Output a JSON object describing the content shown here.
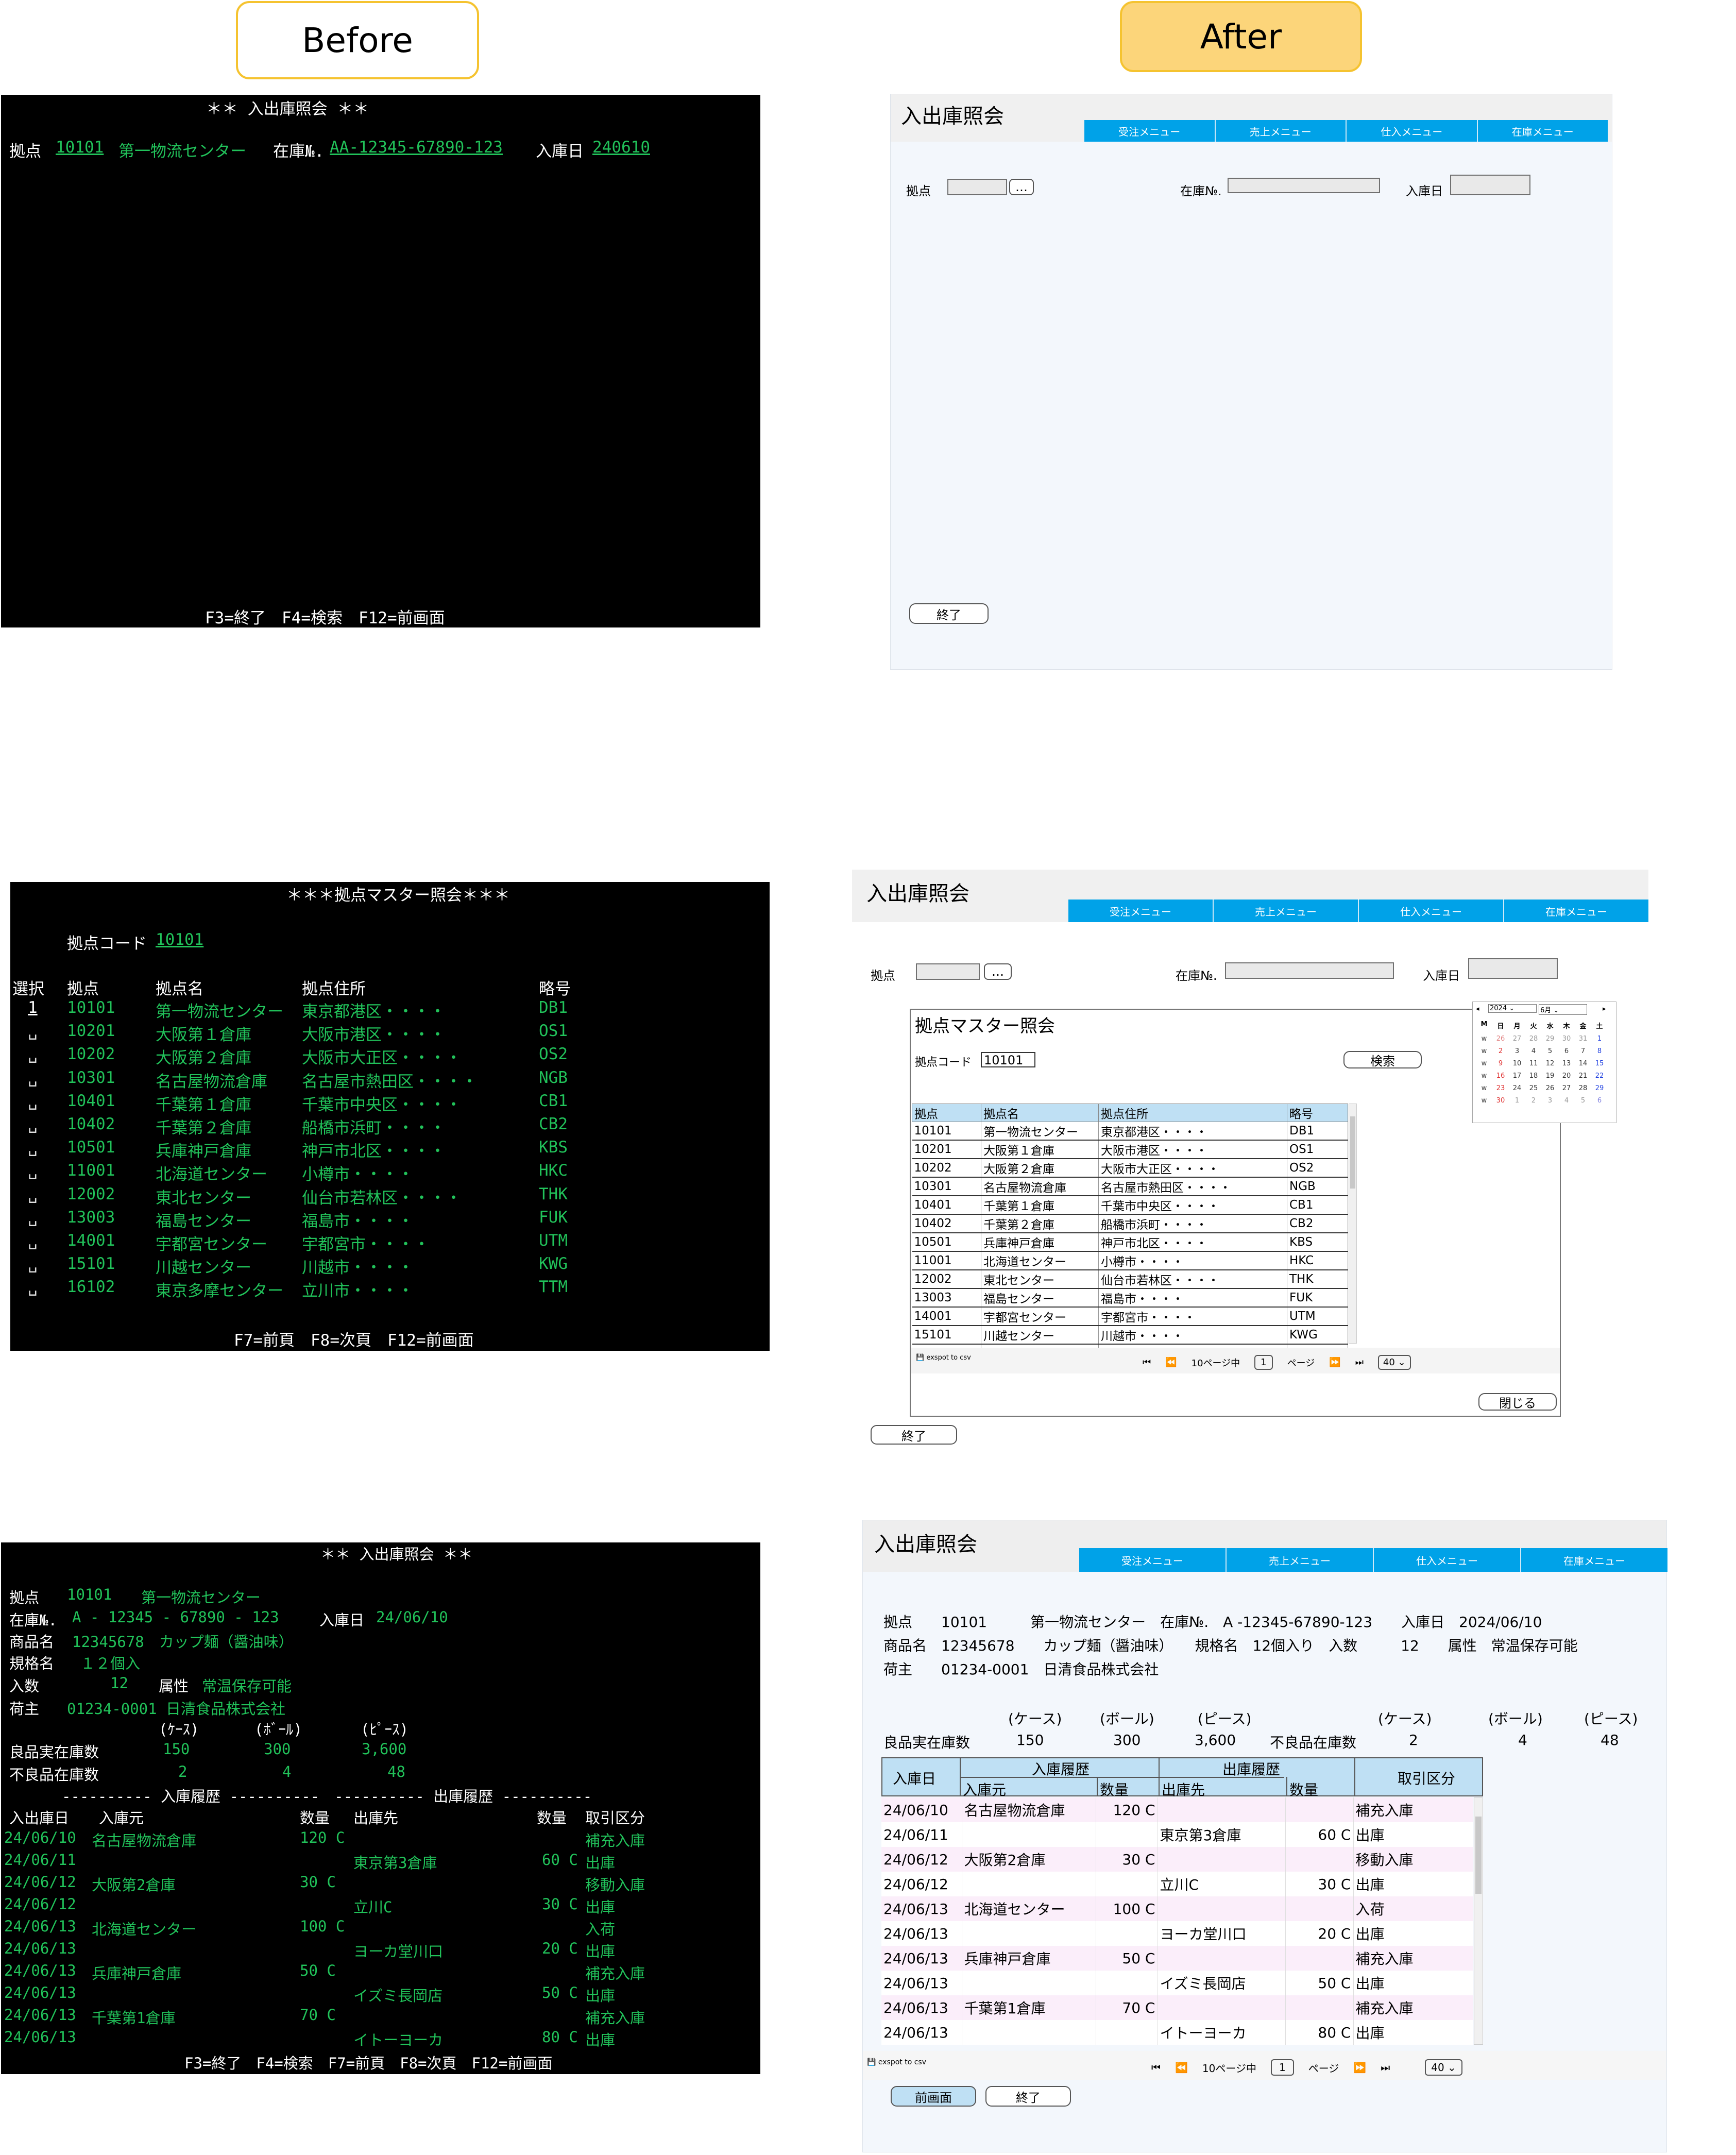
{
  "labels": {
    "before": "Before",
    "after": "After"
  },
  "s1": {
    "title": "＊＊ 入出庫照会 ＊＊",
    "lbl_kyoten": "拠点",
    "kyoten": "10101",
    "kyoten_name": "第一物流センター",
    "lbl_zaiko": "在庫№.",
    "zaiko": "AA-12345-67890-123",
    "lbl_date": "入庫日",
    "date": "240610",
    "fkeys": "F3=終了　F4=検索　F12=前画面"
  },
  "a1": {
    "title": "入出庫照会",
    "menu": [
      "受注メニュー",
      "売上メニュー",
      "仕入メニュー",
      "在庫メニュー"
    ],
    "lbl_kyoten": "拠点",
    "lookup": "…",
    "lbl_zaiko": "在庫№.",
    "lbl_date": "入庫日",
    "end": "終了"
  },
  "s2": {
    "title": "＊＊＊拠点マスター照会＊＊＊",
    "lbl_code": "拠点コード",
    "code": "10101",
    "headers": [
      "選択",
      "拠点",
      "拠点名",
      "拠点住所",
      "略号"
    ],
    "sel_first": "1",
    "sel": "␣",
    "rows": [
      [
        "10101",
        "第一物流センター",
        "東京都港区・・・・",
        "DB1"
      ],
      [
        "10201",
        "大阪第１倉庫",
        "大阪市港区・・・・",
        "OS1"
      ],
      [
        "10202",
        "大阪第２倉庫",
        "大阪市大正区・・・・",
        "OS2"
      ],
      [
        "10301",
        "名古屋物流倉庫",
        "名古屋市熱田区・・・・",
        "NGB"
      ],
      [
        "10401",
        "千葉第１倉庫",
        "千葉市中央区・・・・",
        "CB1"
      ],
      [
        "10402",
        "千葉第２倉庫",
        "船橋市浜町・・・・",
        "CB2"
      ],
      [
        "10501",
        "兵庫神戸倉庫",
        "神戸市北区・・・・",
        "KBS"
      ],
      [
        "11001",
        "北海道センター",
        "小樽市・・・・",
        "HKC"
      ],
      [
        "12002",
        "東北センター",
        "仙台市若林区・・・・",
        "THK"
      ],
      [
        "13003",
        "福島センター",
        "福島市・・・・",
        "FUK"
      ],
      [
        "14001",
        "宇都宮センター",
        "宇都宮市・・・・",
        "UTM"
      ],
      [
        "15101",
        "川越センター",
        "川越市・・・・",
        "KWG"
      ],
      [
        "16102",
        "東京多摩センター",
        "立川市・・・・",
        "TTM"
      ]
    ],
    "fkeys": "F7=前頁　F8=次頁　F12=前画面"
  },
  "a2": {
    "title": "入出庫照会",
    "menu": [
      "受注メニュー",
      "売上メニュー",
      "仕入メニュー",
      "在庫メニュー"
    ],
    "lbl_kyoten": "拠点",
    "lookup": "…",
    "lbl_zaiko": "在庫№.",
    "lbl_date": "入庫日",
    "modal": {
      "title": "拠点マスター照会",
      "lbl_code": "拠点コード",
      "code": "10101",
      "search": "検索",
      "headers": [
        "拠点",
        "拠点名",
        "拠点住所",
        "略号"
      ],
      "export": "exspot to csv",
      "page_of": "10ページ中",
      "page": "1",
      "page_unit": "ページ",
      "page_size": "40",
      "close": "閉じる"
    },
    "calendar": {
      "year": "2024",
      "month": "6月",
      "dow": [
        "M",
        "日",
        "月",
        "火",
        "水",
        "木",
        "金",
        "土"
      ],
      "weeks": [
        [
          "w",
          "26",
          "27",
          "28",
          "29",
          "30",
          "31",
          "1"
        ],
        [
          "w",
          "2",
          "3",
          "4",
          "5",
          "6",
          "7",
          "8"
        ],
        [
          "w",
          "9",
          "10",
          "11",
          "12",
          "13",
          "14",
          "15"
        ],
        [
          "w",
          "16",
          "17",
          "18",
          "19",
          "20",
          "21",
          "22"
        ],
        [
          "w",
          "23",
          "24",
          "25",
          "26",
          "27",
          "28",
          "29"
        ],
        [
          "w",
          "30",
          "1",
          "2",
          "3",
          "4",
          "5",
          "6"
        ]
      ],
      "colors": {
        "sun": "#e03030",
        "sat": "#2040e0",
        "other": "#999999"
      }
    },
    "end": "終了"
  },
  "s3": {
    "title": "＊＊ 入出庫照会 ＊＊",
    "l1": "拠点",
    "v1": "10101",
    "v1b": "第一物流センター",
    "l2": "在庫№.",
    "v2": "A - 12345 - 67890 - 123",
    "l2b": "入庫日",
    "v2b": "24/06/10",
    "l3": "商品名",
    "v3": "12345678　カップ麺（醤油味）",
    "l4": "規格名",
    "v4": "１２個入",
    "l5": "入数",
    "v5": "12",
    "l5b": "属性",
    "v5b": "常温保存可能",
    "l6": "荷主",
    "v6": "01234-0001 日清食品株式会社",
    "units": [
      "(ｹｰｽ)",
      "(ﾎﾞｰﾙ)",
      "(ﾋﾟｰｽ)"
    ],
    "l7": "良品実在庫数",
    "good": [
      "150",
      "300",
      "3,600"
    ],
    "l8": "不良品在庫数",
    "bad": [
      "2",
      "4",
      "48"
    ],
    "section": "---------- 入庫履歴 ----------　---------- 出庫履歴 ----------",
    "hdr": [
      "入出庫日",
      "入庫元",
      "数量",
      "出庫先",
      "数量",
      "取引区分"
    ],
    "rows": [
      [
        "24/06/10",
        "名古屋物流倉庫",
        "120 C",
        "",
        "",
        "補充入庫"
      ],
      [
        "24/06/11",
        "",
        "",
        "東京第3倉庫",
        "60 C",
        "出庫"
      ],
      [
        "24/06/12",
        "大阪第2倉庫",
        "30 C",
        "",
        "",
        "移動入庫"
      ],
      [
        "24/06/12",
        "",
        "",
        "立川C",
        "30 C",
        "出庫"
      ],
      [
        "24/06/13",
        "北海道センター",
        "100 C",
        "",
        "",
        "入荷"
      ],
      [
        "24/06/13",
        "",
        "",
        "ヨーカ堂川口",
        "20 C",
        "出庫"
      ],
      [
        "24/06/13",
        "兵庫神戸倉庫",
        "50 C",
        "",
        "",
        "補充入庫"
      ],
      [
        "24/06/13",
        "",
        "",
        "イズミ長岡店",
        "50 C",
        "出庫"
      ],
      [
        "24/06/13",
        "千葉第1倉庫",
        "70 C",
        "",
        "",
        "補充入庫"
      ],
      [
        "24/06/13",
        "",
        "",
        "イトーヨーカ",
        "80 C",
        "出庫"
      ]
    ],
    "fkeys": "F3=終了　F4=検索　F7=前頁　F8=次頁　F12=前画面"
  },
  "a3": {
    "title": "入出庫照会",
    "menu": [
      "受注メニュー",
      "売上メニュー",
      "仕入メニュー",
      "在庫メニュー"
    ],
    "info1": "拠点　　10101　　　第一物流センター　在庫№.　A -12345-67890-123　　入庫日　2024/06/10",
    "info2": "商品名　12345678　　カップ麺（醤油味）　　規格名　12個入り　入数　　　12　　属性　常温保存可能",
    "info3": "荷主　　01234-0001　日清食品株式会社",
    "units": [
      "(ケース)",
      "(ボール)",
      "(ピース)"
    ],
    "l_good": "良品実在庫数",
    "good": [
      "150",
      "300",
      "3,600"
    ],
    "l_bad": "不良品在庫数",
    "bad": [
      "2",
      "4",
      "48"
    ],
    "hdr_date": "入庫日",
    "hdr_in": "入庫履歴",
    "hdr_out": "出庫履歴",
    "hdr_kind": "取引区分",
    "hdr_in_from": "入庫元",
    "hdr_qty": "数量",
    "hdr_out_to": "出庫先",
    "rows": [
      [
        "24/06/10",
        "名古屋物流倉庫",
        "120 C",
        "",
        "",
        "補充入庫"
      ],
      [
        "24/06/11",
        "",
        "",
        "東京第3倉庫",
        "60 C",
        "出庫"
      ],
      [
        "24/06/12",
        "大阪第2倉庫",
        "30 C",
        "",
        "",
        "移動入庫"
      ],
      [
        "24/06/12",
        "",
        "",
        "立川C",
        "30 C",
        "出庫"
      ],
      [
        "24/06/13",
        "北海道センター",
        "100 C",
        "",
        "",
        "入荷"
      ],
      [
        "24/06/13",
        "",
        "",
        "ヨーカ堂川口",
        "20 C",
        "出庫"
      ],
      [
        "24/06/13",
        "兵庫神戸倉庫",
        "50 C",
        "",
        "",
        "補充入庫"
      ],
      [
        "24/06/13",
        "",
        "",
        "イズミ長岡店",
        "50 C",
        "出庫"
      ],
      [
        "24/06/13",
        "千葉第1倉庫",
        "70 C",
        "",
        "",
        "補充入庫"
      ],
      [
        "24/06/13",
        "",
        "",
        "イトーヨーカ",
        "80 C",
        "出庫"
      ]
    ],
    "export": "exspot to csv",
    "page_of": "10ページ中",
    "page": "1",
    "page_unit": "ページ",
    "page_size": "40",
    "prev": "前画面",
    "end": "終了"
  }
}
